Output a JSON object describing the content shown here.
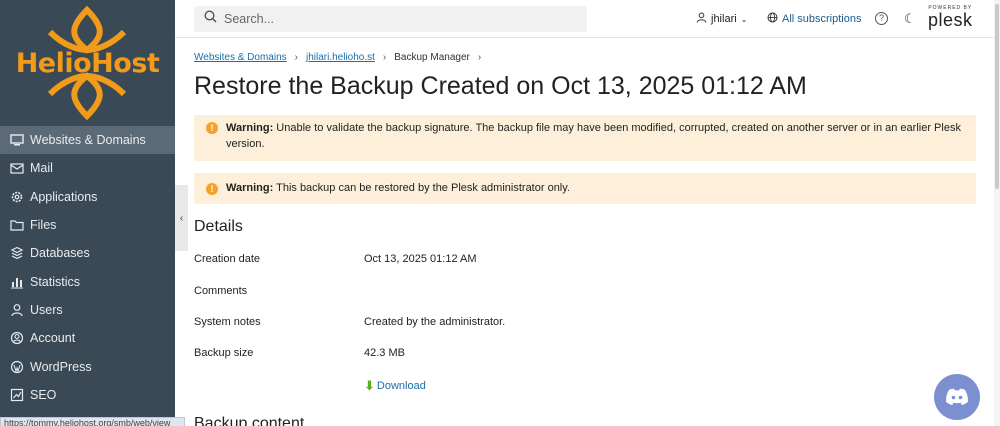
{
  "brand": {
    "name": "HelioHost",
    "color": "#f29b1b"
  },
  "sidebar": {
    "items": [
      {
        "label": "Websites & Domains",
        "icon": "monitor-icon",
        "active": true
      },
      {
        "label": "Mail",
        "icon": "mail-icon"
      },
      {
        "label": "Applications",
        "icon": "gear-icon"
      },
      {
        "label": "Files",
        "icon": "folder-icon"
      },
      {
        "label": "Databases",
        "icon": "database-icon"
      },
      {
        "label": "Statistics",
        "icon": "bar-chart-icon"
      },
      {
        "label": "Users",
        "icon": "user-icon"
      },
      {
        "label": "Account",
        "icon": "account-icon"
      },
      {
        "label": "WordPress",
        "icon": "wordpress-icon"
      },
      {
        "label": "SEO",
        "icon": "seo-chart-icon"
      }
    ]
  },
  "status_bar": {
    "url": "https://tommy.heliohost.org/smb/web/view"
  },
  "topbar": {
    "search_placeholder": "Search...",
    "user": "jhilari",
    "subscriptions": "All subscriptions",
    "powered_by": "POWERED BY",
    "plesk": "plesk"
  },
  "breadcrumb": [
    {
      "label": "Websites & Domains",
      "link": true
    },
    {
      "label": "jhilari.helioho.st",
      "link": true
    },
    {
      "label": "Backup Manager",
      "link": false
    }
  ],
  "page_title": "Restore the Backup Created on Oct 13, 2025 01:12 AM",
  "alerts": [
    {
      "strong": "Warning:",
      "text": " Unable to validate the backup signature. The backup file may have been modified, corrupted, created on another server or in an earlier Plesk version."
    },
    {
      "strong": "Warning:",
      "text": " This backup can be restored by the Plesk administrator only."
    }
  ],
  "details": {
    "heading": "Details",
    "rows": [
      {
        "label": "Creation date",
        "value": "Oct 13, 2025 01:12 AM"
      },
      {
        "label": "Comments",
        "value": ""
      },
      {
        "label": "System notes",
        "value": "Created by the administrator."
      },
      {
        "label": "Backup size",
        "value": "42.3 MB"
      }
    ],
    "download_label": "Download"
  },
  "backup_content_heading": "Backup content",
  "colors": {
    "sidebar_bg": "#394955",
    "alert_bg": "#fdefd9",
    "link": "#1b6ea8",
    "discord": "#7b8fd1"
  }
}
